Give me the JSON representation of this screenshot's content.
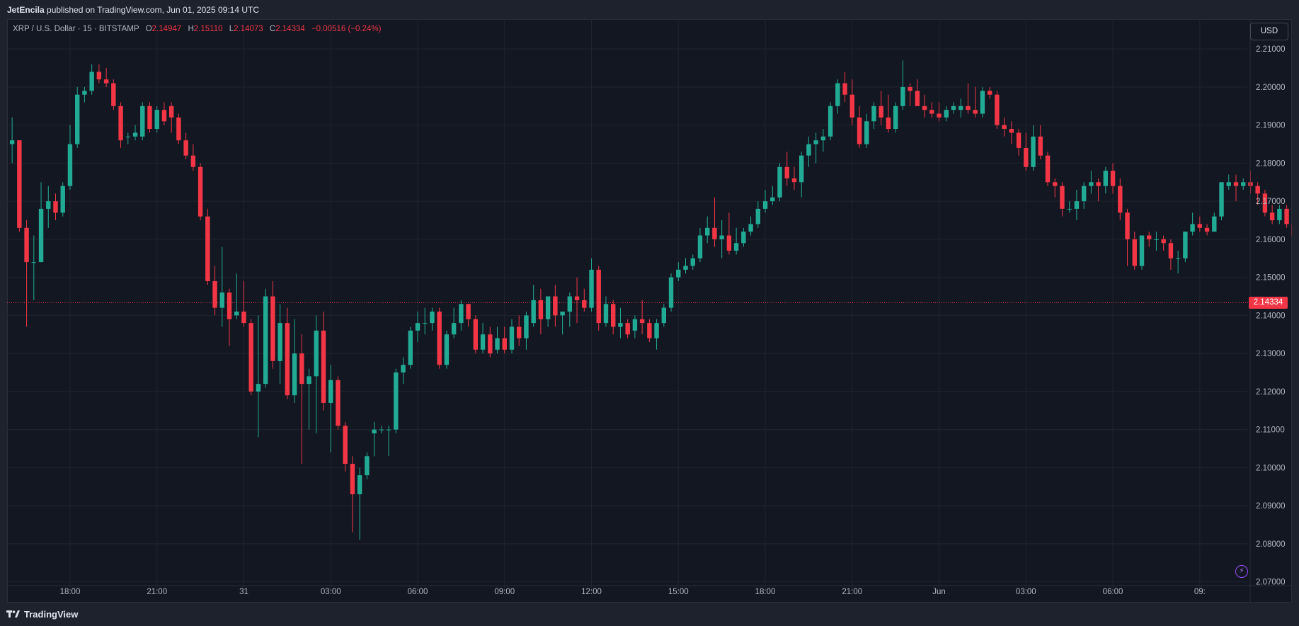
{
  "header": {
    "author": "JetEncila",
    "published_text": "published on TradingView.com, Jun 01, 2025 09:14 UTC"
  },
  "legend": {
    "symbol": "XRP / U.S. Dollar · 15 · BITSTAMP",
    "o_label": "O",
    "o_value": "2.14947",
    "h_label": "H",
    "h_value": "2.15110",
    "l_label": "L",
    "l_value": "2.14073",
    "c_label": "C",
    "c_value": "2.14334",
    "change": "−0.00516 (−0.24%)"
  },
  "currency_button": "USD",
  "last_price_label": "2.14334",
  "footer": {
    "brand": "TradingView"
  },
  "colors": {
    "up": "#22ab94",
    "down": "#f23645",
    "background": "#131722",
    "grid": "#1f2430",
    "last_price_line": "#f23645"
  },
  "icons": [
    "tradingview-logo-icon",
    "lightning-icon"
  ],
  "chart_data": {
    "type": "candlestick",
    "interval": "15",
    "y_axis_side": "right",
    "ylim": [
      2.0675,
      2.2145
    ],
    "ytick_labels": [
      "2.07000",
      "2.08000",
      "2.09000",
      "2.10000",
      "2.11000",
      "2.12000",
      "2.13000",
      "2.14000",
      "2.15000",
      "2.16000",
      "2.17000",
      "2.18000",
      "2.19000",
      "2.20000",
      "2.21000"
    ],
    "yticks": [
      2.07,
      2.08,
      2.09,
      2.1,
      2.11,
      2.12,
      2.13,
      2.14,
      2.15,
      2.16,
      2.17,
      2.18,
      2.19,
      2.2,
      2.21
    ],
    "xtick_labels": [
      "18:00",
      "21:00",
      "31",
      "03:00",
      "06:00",
      "09:00",
      "12:00",
      "15:00",
      "18:00",
      "21:00",
      "Jun",
      "03:00",
      "06:00",
      "09:"
    ],
    "xtick_candle_index": [
      8,
      20,
      32,
      44,
      56,
      68,
      80,
      92,
      104,
      116,
      128,
      140,
      152,
      164
    ],
    "last_price": 2.14334,
    "grid": true,
    "candles": [
      [
        2.185,
        2.192,
        2.18,
        2.186
      ],
      [
        2.186,
        2.186,
        2.162,
        2.163
      ],
      [
        2.163,
        2.165,
        2.137,
        2.154
      ],
      [
        2.154,
        2.161,
        2.144,
        2.154
      ],
      [
        2.154,
        2.175,
        2.154,
        2.168
      ],
      [
        2.168,
        2.174,
        2.163,
        2.17
      ],
      [
        2.17,
        2.172,
        2.165,
        2.167
      ],
      [
        2.167,
        2.175,
        2.166,
        2.174
      ],
      [
        2.174,
        2.19,
        2.173,
        2.185
      ],
      [
        2.185,
        2.2,
        2.184,
        2.198
      ],
      [
        2.198,
        2.2,
        2.196,
        2.199
      ],
      [
        2.199,
        2.206,
        2.198,
        2.204
      ],
      [
        2.204,
        2.206,
        2.201,
        2.202
      ],
      [
        2.202,
        2.205,
        2.2,
        2.201
      ],
      [
        2.201,
        2.202,
        2.194,
        2.195
      ],
      [
        2.195,
        2.196,
        2.184,
        2.186
      ],
      [
        2.187,
        2.188,
        2.185,
        2.187
      ],
      [
        2.187,
        2.19,
        2.186,
        2.188
      ],
      [
        2.187,
        2.196,
        2.186,
        2.195
      ],
      [
        2.195,
        2.196,
        2.188,
        2.189
      ],
      [
        2.189,
        2.195,
        2.188,
        2.194
      ],
      [
        2.194,
        2.196,
        2.19,
        2.191
      ],
      [
        2.195,
        2.196,
        2.188,
        2.192
      ],
      [
        2.192,
        2.193,
        2.185,
        2.186
      ],
      [
        2.186,
        2.188,
        2.181,
        2.182
      ],
      [
        2.182,
        2.185,
        2.178,
        2.179
      ],
      [
        2.179,
        2.18,
        2.165,
        2.166
      ],
      [
        2.166,
        2.168,
        2.148,
        2.149
      ],
      [
        2.149,
        2.153,
        2.14,
        2.142
      ],
      [
        2.142,
        2.158,
        2.137,
        2.146
      ],
      [
        2.146,
        2.147,
        2.132,
        2.139
      ],
      [
        2.14,
        2.151,
        2.139,
        2.141
      ],
      [
        2.141,
        2.149,
        2.137,
        2.138
      ],
      [
        2.138,
        2.139,
        2.119,
        2.12
      ],
      [
        2.12,
        2.14,
        2.108,
        2.122
      ],
      [
        2.122,
        2.147,
        2.121,
        2.145
      ],
      [
        2.145,
        2.149,
        2.126,
        2.128
      ],
      [
        2.128,
        2.143,
        2.122,
        2.138
      ],
      [
        2.138,
        2.142,
        2.118,
        2.119
      ],
      [
        2.119,
        2.139,
        2.117,
        2.13
      ],
      [
        2.13,
        2.135,
        2.101,
        2.122
      ],
      [
        2.122,
        2.126,
        2.11,
        2.124
      ],
      [
        2.124,
        2.14,
        2.109,
        2.136
      ],
      [
        2.136,
        2.141,
        2.115,
        2.117
      ],
      [
        2.117,
        2.127,
        2.104,
        2.123
      ],
      [
        2.123,
        2.124,
        2.11,
        2.111
      ],
      [
        2.111,
        2.112,
        2.099,
        2.101
      ],
      [
        2.101,
        2.103,
        2.083,
        2.093
      ],
      [
        2.093,
        2.1,
        2.081,
        2.098
      ],
      [
        2.098,
        2.104,
        2.097,
        2.103
      ],
      [
        2.109,
        2.112,
        2.103,
        2.11
      ],
      [
        2.11,
        2.111,
        2.109,
        2.11
      ],
      [
        2.11,
        2.111,
        2.103,
        2.11
      ],
      [
        2.11,
        2.126,
        2.109,
        2.125
      ],
      [
        2.125,
        2.129,
        2.122,
        2.127
      ],
      [
        2.127,
        2.137,
        2.126,
        2.136
      ],
      [
        2.136,
        2.141,
        2.133,
        2.138
      ],
      [
        2.138,
        2.142,
        2.135,
        2.138
      ],
      [
        2.138,
        2.142,
        2.136,
        2.141
      ],
      [
        2.141,
        2.142,
        2.126,
        2.127
      ],
      [
        2.127,
        2.136,
        2.126,
        2.135
      ],
      [
        2.135,
        2.142,
        2.134,
        2.138
      ],
      [
        2.138,
        2.144,
        2.136,
        2.143
      ],
      [
        2.143,
        2.143,
        2.137,
        2.139
      ],
      [
        2.139,
        2.14,
        2.13,
        2.131
      ],
      [
        2.131,
        2.138,
        2.13,
        2.135
      ],
      [
        2.135,
        2.137,
        2.129,
        2.13
      ],
      [
        2.131,
        2.137,
        2.13,
        2.134
      ],
      [
        2.134,
        2.137,
        2.13,
        2.131
      ],
      [
        2.131,
        2.139,
        2.13,
        2.137
      ],
      [
        2.137,
        2.14,
        2.132,
        2.134
      ],
      [
        2.134,
        2.141,
        2.131,
        2.14
      ],
      [
        2.138,
        2.148,
        2.137,
        2.144
      ],
      [
        2.144,
        2.147,
        2.135,
        2.139
      ],
      [
        2.139,
        2.145,
        2.137,
        2.145
      ],
      [
        2.145,
        2.148,
        2.137,
        2.14
      ],
      [
        2.14,
        2.141,
        2.135,
        2.141
      ],
      [
        2.141,
        2.146,
        2.137,
        2.145
      ],
      [
        2.145,
        2.15,
        2.138,
        2.144
      ],
      [
        2.144,
        2.147,
        2.141,
        2.142
      ],
      [
        2.142,
        2.155,
        2.141,
        2.152
      ],
      [
        2.152,
        2.153,
        2.136,
        2.138
      ],
      [
        2.138,
        2.145,
        2.137,
        2.143
      ],
      [
        2.143,
        2.144,
        2.135,
        2.137
      ],
      [
        2.137,
        2.142,
        2.134,
        2.138
      ],
      [
        2.138,
        2.139,
        2.134,
        2.135
      ],
      [
        2.136,
        2.14,
        2.134,
        2.139
      ],
      [
        2.139,
        2.144,
        2.135,
        2.138
      ],
      [
        2.138,
        2.139,
        2.133,
        2.134
      ],
      [
        2.134,
        2.139,
        2.131,
        2.138
      ],
      [
        2.138,
        2.143,
        2.137,
        2.142
      ],
      [
        2.142,
        2.151,
        2.141,
        2.15
      ],
      [
        2.15,
        2.154,
        2.149,
        2.152
      ],
      [
        2.152,
        2.155,
        2.151,
        2.153
      ],
      [
        2.153,
        2.156,
        2.152,
        2.155
      ],
      [
        2.155,
        2.163,
        2.154,
        2.161
      ],
      [
        2.161,
        2.166,
        2.159,
        2.163
      ],
      [
        2.163,
        2.171,
        2.158,
        2.16
      ],
      [
        2.16,
        2.165,
        2.155,
        2.161
      ],
      [
        2.161,
        2.167,
        2.156,
        2.157
      ],
      [
        2.157,
        2.163,
        2.156,
        2.159
      ],
      [
        2.159,
        2.163,
        2.158,
        2.162
      ],
      [
        2.162,
        2.166,
        2.161,
        2.164
      ],
      [
        2.164,
        2.17,
        2.163,
        2.168
      ],
      [
        2.168,
        2.173,
        2.167,
        2.17
      ],
      [
        2.17,
        2.174,
        2.169,
        2.171
      ],
      [
        2.171,
        2.18,
        2.17,
        2.179
      ],
      [
        2.179,
        2.183,
        2.174,
        2.176
      ],
      [
        2.176,
        2.179,
        2.173,
        2.175
      ],
      [
        2.175,
        2.183,
        2.171,
        2.182
      ],
      [
        2.182,
        2.187,
        2.179,
        2.185
      ],
      [
        2.185,
        2.188,
        2.18,
        2.186
      ],
      [
        2.186,
        2.189,
        2.183,
        2.187
      ],
      [
        2.187,
        2.196,
        2.186,
        2.195
      ],
      [
        2.195,
        2.202,
        2.193,
        2.201
      ],
      [
        2.201,
        2.204,
        2.196,
        2.198
      ],
      [
        2.198,
        2.202,
        2.19,
        2.192
      ],
      [
        2.192,
        2.195,
        2.184,
        2.185
      ],
      [
        2.185,
        2.193,
        2.184,
        2.191
      ],
      [
        2.191,
        2.196,
        2.189,
        2.195
      ],
      [
        2.195,
        2.199,
        2.19,
        2.192
      ],
      [
        2.192,
        2.198,
        2.188,
        2.189
      ],
      [
        2.189,
        2.196,
        2.188,
        2.195
      ],
      [
        2.195,
        2.207,
        2.194,
        2.2
      ],
      [
        2.2,
        2.201,
        2.195,
        2.199
      ],
      [
        2.199,
        2.202,
        2.195,
        2.195
      ],
      [
        2.195,
        2.198,
        2.192,
        2.194
      ],
      [
        2.194,
        2.196,
        2.192,
        2.193
      ],
      [
        2.193,
        2.196,
        2.191,
        2.192
      ],
      [
        2.192,
        2.195,
        2.191,
        2.194
      ],
      [
        2.194,
        2.196,
        2.193,
        2.195
      ],
      [
        2.194,
        2.197,
        2.192,
        2.195
      ],
      [
        2.195,
        2.201,
        2.193,
        2.194
      ],
      [
        2.194,
        2.2,
        2.192,
        2.193
      ],
      [
        2.193,
        2.2,
        2.192,
        2.199
      ],
      [
        2.199,
        2.2,
        2.197,
        2.198
      ],
      [
        2.198,
        2.199,
        2.189,
        2.19
      ],
      [
        2.19,
        2.192,
        2.187,
        2.189
      ],
      [
        2.189,
        2.191,
        2.185,
        2.188
      ],
      [
        2.188,
        2.189,
        2.182,
        2.184
      ],
      [
        2.184,
        2.188,
        2.178,
        2.179
      ],
      [
        2.179,
        2.19,
        2.178,
        2.187
      ],
      [
        2.187,
        2.19,
        2.181,
        2.182
      ],
      [
        2.182,
        2.183,
        2.174,
        2.175
      ],
      [
        2.175,
        2.176,
        2.171,
        2.174
      ],
      [
        2.174,
        2.175,
        2.166,
        2.168
      ],
      [
        2.168,
        2.17,
        2.167,
        2.168
      ],
      [
        2.168,
        2.173,
        2.165,
        2.17
      ],
      [
        2.17,
        2.175,
        2.168,
        2.174
      ],
      [
        2.174,
        2.178,
        2.172,
        2.175
      ],
      [
        2.175,
        2.176,
        2.17,
        2.174
      ],
      [
        2.174,
        2.179,
        2.172,
        2.178
      ],
      [
        2.178,
        2.18,
        2.172,
        2.174
      ],
      [
        2.174,
        2.176,
        2.165,
        2.167
      ],
      [
        2.167,
        2.168,
        2.153,
        2.16
      ],
      [
        2.16,
        2.162,
        2.152,
        2.153
      ],
      [
        2.153,
        2.161,
        2.152,
        2.161
      ],
      [
        2.161,
        2.162,
        2.158,
        2.16
      ],
      [
        2.16,
        2.162,
        2.157,
        2.16
      ],
      [
        2.16,
        2.161,
        2.157,
        2.159
      ],
      [
        2.159,
        2.16,
        2.152,
        2.155
      ],
      [
        2.155,
        2.157,
        2.151,
        2.155
      ],
      [
        2.155,
        2.162,
        2.154,
        2.162
      ],
      [
        2.162,
        2.167,
        2.161,
        2.164
      ],
      [
        2.164,
        2.166,
        2.162,
        2.163
      ],
      [
        2.163,
        2.164,
        2.161,
        2.162
      ],
      [
        2.162,
        2.167,
        2.162,
        2.166
      ],
      [
        2.166,
        2.171,
        2.165,
        2.175
      ],
      [
        2.174,
        2.177,
        2.173,
        2.175
      ],
      [
        2.175,
        2.177,
        2.17,
        2.174
      ],
      [
        2.174,
        2.176,
        2.173,
        2.175
      ],
      [
        2.175,
        2.178,
        2.172,
        2.174
      ],
      [
        2.174,
        2.175,
        2.169,
        2.172
      ],
      [
        2.172,
        2.173,
        2.166,
        2.167
      ],
      [
        2.167,
        2.169,
        2.164,
        2.165
      ],
      [
        2.165,
        2.169,
        2.164,
        2.168
      ],
      [
        2.168,
        2.169,
        2.163,
        2.164
      ],
      [
        2.164,
        2.165,
        2.158,
        2.161
      ],
      [
        2.161,
        2.164,
        2.156,
        2.163
      ],
      [
        2.163,
        2.164,
        2.156,
        2.157
      ],
      [
        2.157,
        2.16,
        2.153,
        2.159
      ],
      [
        2.159,
        2.162,
        2.152,
        2.155
      ],
      [
        2.155,
        2.156,
        2.15,
        2.151
      ],
      [
        2.152,
        2.154,
        2.148,
        2.153
      ],
      [
        2.153,
        2.154,
        2.146,
        2.151
      ],
      [
        2.151,
        2.152,
        2.141,
        2.143
      ]
    ]
  }
}
